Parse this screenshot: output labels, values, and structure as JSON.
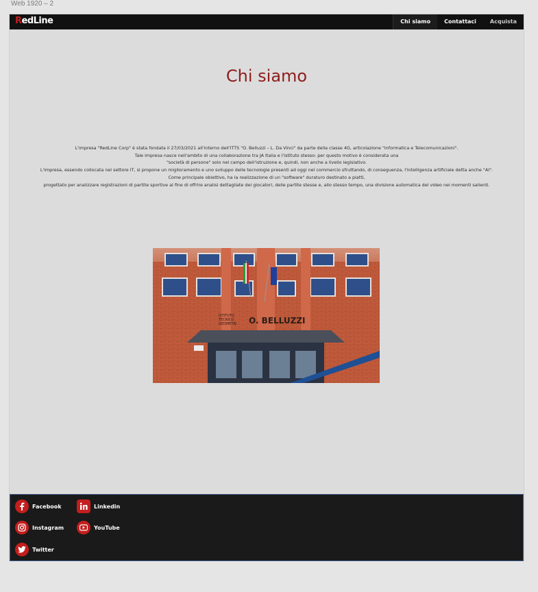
{
  "frame": {
    "label": "Web 1920 – 2"
  },
  "nav": {
    "logo_first": "R",
    "logo_rest": "edLine",
    "items": [
      {
        "label": "Chi siamo"
      },
      {
        "label": "Contattaci"
      },
      {
        "label": "Acquista"
      }
    ]
  },
  "main": {
    "title": "Chi siamo",
    "paragraph_lines": [
      "L'impresa \"RedLine Corp\" è stata fondata il 27/03/2021 all'interno dell'ITTS \"O. Belluzzi – L. Da Vinci\" da parte della classe 4G, articolazione \"informatica e Telecomunicazioni\".",
      "Tale impresa nasce nell'ambito di una collaborazione tra JA Italia e l'istituto stesso: per questo motivo è considerata una",
      "\"società di persone\" solo nel campo dell'istruzione e, quindi, non anche a livello legislativo.",
      "L'impresa, essendo collocata nel settore IT, si propone un miglioramento e uno sviluppo delle tecnologie presenti ad oggi nel commercio sfruttando, di conseguenza, l'intelligenza artificiale detta anche \"AI\".",
      "Come principale obiettivo, ha la realizzazione di un \"software\" duraturo destinato a piattì,",
      "progettato per analizzare registrazioni di partite sportive al fine di offrire analisi dettagliate dei giocatori, delle partite stesse e, allo stesso tempo, una divisione automatica del video nei momenti salienti."
    ],
    "photo_sign_line1": "ISTITUTO\nTECNICO\nGEOMETRI",
    "photo_sign_main": "O. BELLUZZI"
  },
  "footer": {
    "links": [
      {
        "label": "Facebook",
        "icon": "facebook-icon"
      },
      {
        "label": "Linkedin",
        "icon": "linkedin-icon"
      },
      {
        "label": "Instagram",
        "icon": "instagram-icon"
      },
      {
        "label": "YouTube",
        "icon": "youtube-icon"
      },
      {
        "label": "Twitter",
        "icon": "twitter-icon"
      }
    ]
  },
  "colors": {
    "accent_red": "#c41e1e",
    "title_red": "#8e1c1c",
    "nav_bg": "#111111",
    "footer_bg": "#1a1a1a"
  }
}
